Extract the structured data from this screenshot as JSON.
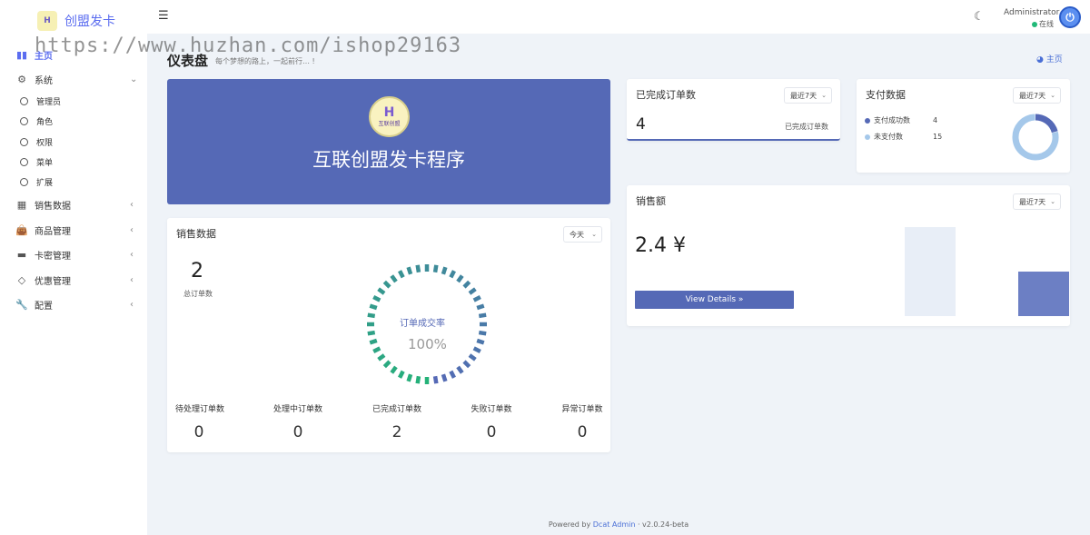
{
  "brand": {
    "name": "创盟发卡",
    "logo_text": "H"
  },
  "header": {
    "admin_name": "Administrator",
    "admin_status": "在线",
    "menu_icon": "hamburger-icon",
    "theme_icon": "moon-icon"
  },
  "watermark": "https://www.huzhan.com/ishop29163",
  "sidebar": {
    "items": [
      {
        "label": "主页",
        "icon": "bar-chart-icon"
      },
      {
        "label": "系统",
        "icon": "gear-icon"
      },
      {
        "label": "管理员"
      },
      {
        "label": "角色"
      },
      {
        "label": "权限"
      },
      {
        "label": "菜单"
      },
      {
        "label": "扩展"
      },
      {
        "label": "销售数据",
        "icon": "table-icon"
      },
      {
        "label": "商品管理",
        "icon": "bag-icon"
      },
      {
        "label": "卡密管理",
        "icon": "card-icon"
      },
      {
        "label": "优惠管理",
        "icon": "diamond-icon"
      },
      {
        "label": "配置",
        "icon": "wrench-icon"
      }
    ]
  },
  "page": {
    "title": "仪表盘",
    "subtitle": "每个梦想的路上，一起前行… !",
    "home_link": "主页"
  },
  "banner": {
    "title": "互联创盟发卡程序",
    "logo_text": "H",
    "logo_caption": "互联创盟"
  },
  "completed_orders": {
    "title": "已完成订单数",
    "range": "最近7天",
    "value": "4",
    "label": "已完成订单数"
  },
  "payment": {
    "title": "支付数据",
    "range": "最近7天",
    "legend": [
      {
        "label": "支付成功数",
        "value": "4",
        "color": "#5569b6"
      },
      {
        "label": "未支付数",
        "value": "15",
        "color": "#a5c8ea"
      }
    ]
  },
  "sales_data": {
    "title": "销售数据",
    "range": "今天",
    "total_value": "2",
    "total_label": "总订单数",
    "gauge_label": "订单成交率",
    "gauge_value": "100%",
    "gauge_fraction": 1.0,
    "stats": [
      {
        "label": "待处理订单数",
        "value": "0"
      },
      {
        "label": "处理中订单数",
        "value": "0"
      },
      {
        "label": "已完成订单数",
        "value": "2"
      },
      {
        "label": "失败订单数",
        "value": "0"
      },
      {
        "label": "异常订单数",
        "value": "0"
      }
    ]
  },
  "sales_amount": {
    "title": "销售额",
    "range": "最近7天",
    "value": "2.4 ¥",
    "button": "View Details »"
  },
  "chart_data": [
    {
      "type": "pie",
      "categories": [
        "支付成功数",
        "未支付数"
      ],
      "values": [
        4,
        15
      ],
      "title": "支付数据"
    },
    {
      "type": "bar",
      "categories": [
        "",
        ""
      ],
      "values": [
        1.0,
        0.5
      ]
    }
  ],
  "footer": {
    "prefix": "Powered by",
    "link": "Dcat Admin",
    "sep": "·",
    "version": "v2.0.24-beta"
  }
}
